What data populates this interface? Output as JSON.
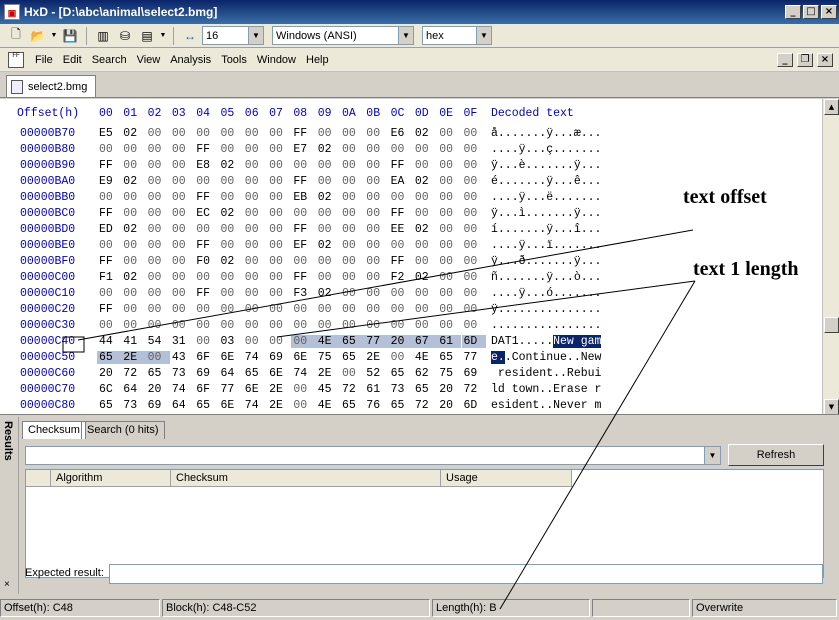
{
  "window": {
    "title": "HxD - [D:\\abc\\animal\\select2.bmg]",
    "app_icon": "HxD",
    "controls": [
      "minimize-icon",
      "maximize-icon",
      "close-icon"
    ]
  },
  "toolbar": {
    "bytes_per_row": "16",
    "charset": "Windows (ANSI)",
    "offset_base": "hex",
    "icons": [
      "new-file-icon",
      "open-file-icon",
      "save-icon",
      "chip-icon",
      "disk-icon",
      "page-icon",
      "arrows-icon"
    ]
  },
  "menu": {
    "items": [
      "File",
      "Edit",
      "Search",
      "View",
      "Analysis",
      "Tools",
      "Window",
      "Help"
    ]
  },
  "document_tab": {
    "label": "select2.bmg"
  },
  "hex_view": {
    "header_offset": "Offset(h)",
    "column_headers": [
      "00",
      "01",
      "02",
      "03",
      "04",
      "05",
      "06",
      "07",
      "08",
      "09",
      "0A",
      "0B",
      "0C",
      "0D",
      "0E",
      "0F"
    ],
    "header_decoded": "Decoded text",
    "rows": [
      {
        "offset": "00000B70",
        "bytes": [
          "E5",
          "02",
          "00",
          "00",
          "00",
          "00",
          "00",
          "00",
          "FF",
          "00",
          "00",
          "00",
          "E6",
          "02",
          "00",
          "00"
        ],
        "decoded": "å.......ÿ...æ..."
      },
      {
        "offset": "00000B80",
        "bytes": [
          "00",
          "00",
          "00",
          "00",
          "FF",
          "00",
          "00",
          "00",
          "E7",
          "02",
          "00",
          "00",
          "00",
          "00",
          "00",
          "00"
        ],
        "decoded": "....ÿ...ç......."
      },
      {
        "offset": "00000B90",
        "bytes": [
          "FF",
          "00",
          "00",
          "00",
          "E8",
          "02",
          "00",
          "00",
          "00",
          "00",
          "00",
          "00",
          "FF",
          "00",
          "00",
          "00"
        ],
        "decoded": "ÿ...è.......ÿ..."
      },
      {
        "offset": "00000BA0",
        "bytes": [
          "E9",
          "02",
          "00",
          "00",
          "00",
          "00",
          "00",
          "00",
          "FF",
          "00",
          "00",
          "00",
          "EA",
          "02",
          "00",
          "00"
        ],
        "decoded": "é.......ÿ...ê..."
      },
      {
        "offset": "00000BB0",
        "bytes": [
          "00",
          "00",
          "00",
          "00",
          "FF",
          "00",
          "00",
          "00",
          "EB",
          "02",
          "00",
          "00",
          "00",
          "00",
          "00",
          "00"
        ],
        "decoded": "....ÿ...ë......."
      },
      {
        "offset": "00000BC0",
        "bytes": [
          "FF",
          "00",
          "00",
          "00",
          "EC",
          "02",
          "00",
          "00",
          "00",
          "00",
          "00",
          "00",
          "FF",
          "00",
          "00",
          "00"
        ],
        "decoded": "ÿ...ì.......ÿ..."
      },
      {
        "offset": "00000BD0",
        "bytes": [
          "ED",
          "02",
          "00",
          "00",
          "00",
          "00",
          "00",
          "00",
          "FF",
          "00",
          "00",
          "00",
          "EE",
          "02",
          "00",
          "00"
        ],
        "decoded": "í.......ÿ...î..."
      },
      {
        "offset": "00000BE0",
        "bytes": [
          "00",
          "00",
          "00",
          "00",
          "FF",
          "00",
          "00",
          "00",
          "EF",
          "02",
          "00",
          "00",
          "00",
          "00",
          "00",
          "00"
        ],
        "decoded": "....ÿ...ï......."
      },
      {
        "offset": "00000BF0",
        "bytes": [
          "FF",
          "00",
          "00",
          "00",
          "F0",
          "02",
          "00",
          "00",
          "00",
          "00",
          "00",
          "00",
          "FF",
          "00",
          "00",
          "00"
        ],
        "decoded": "ÿ...ð.......ÿ..."
      },
      {
        "offset": "00000C00",
        "bytes": [
          "F1",
          "02",
          "00",
          "00",
          "00",
          "00",
          "00",
          "00",
          "FF",
          "00",
          "00",
          "00",
          "F2",
          "02",
          "00",
          "00"
        ],
        "decoded": "ñ.......ÿ...ò..."
      },
      {
        "offset": "00000C10",
        "bytes": [
          "00",
          "00",
          "00",
          "00",
          "FF",
          "00",
          "00",
          "00",
          "F3",
          "02",
          "00",
          "00",
          "00",
          "00",
          "00",
          "00"
        ],
        "decoded": "....ÿ...ó......."
      },
      {
        "offset": "00000C20",
        "bytes": [
          "FF",
          "00",
          "00",
          "00",
          "00",
          "00",
          "00",
          "00",
          "00",
          "00",
          "00",
          "00",
          "00",
          "00",
          "00",
          "00"
        ],
        "decoded": "ÿ..............."
      },
      {
        "offset": "00000C30",
        "bytes": [
          "00",
          "00",
          "00",
          "00",
          "00",
          "00",
          "00",
          "00",
          "00",
          "00",
          "00",
          "00",
          "00",
          "00",
          "00",
          "00"
        ],
        "decoded": "................"
      },
      {
        "offset": "00000C40",
        "bytes": [
          "44",
          "41",
          "54",
          "31",
          "00",
          "03",
          "00",
          "00",
          "00",
          "4E",
          "65",
          "77",
          "20",
          "67",
          "61",
          "6D"
        ],
        "decoded_plain": "DAT1.....",
        "decoded_sel": "New gam"
      },
      {
        "offset": "00000C50",
        "bytes": [
          "65",
          "2E",
          "00",
          "43",
          "6F",
          "6E",
          "74",
          "69",
          "6E",
          "75",
          "65",
          "2E",
          "00",
          "4E",
          "65",
          "77"
        ],
        "decoded_sel": "e.",
        "decoded_plain": ".Continue..New"
      },
      {
        "offset": "00000C60",
        "bytes": [
          "20",
          "72",
          "65",
          "73",
          "69",
          "64",
          "65",
          "6E",
          "74",
          "2E",
          "00",
          "52",
          "65",
          "62",
          "75",
          "69"
        ],
        "decoded": " resident..Rebui"
      },
      {
        "offset": "00000C70",
        "bytes": [
          "6C",
          "64",
          "20",
          "74",
          "6F",
          "77",
          "6E",
          "2E",
          "00",
          "45",
          "72",
          "61",
          "73",
          "65",
          "20",
          "72"
        ],
        "decoded": "ld town..Erase r"
      },
      {
        "offset": "00000C80",
        "bytes": [
          "65",
          "73",
          "69",
          "64",
          "65",
          "6E",
          "74",
          "2E",
          "00",
          "4E",
          "65",
          "76",
          "65",
          "72",
          "20",
          "6D"
        ],
        "decoded": "esident..Never m"
      }
    ]
  },
  "results": {
    "side_label": "Results",
    "tabs": [
      "Checksum",
      "Search (0 hits)"
    ],
    "refresh_label": "Refresh",
    "columns": [
      "Algorithm",
      "Checksum",
      "Usage"
    ],
    "expected_label": "Expected result:"
  },
  "status": {
    "offset": "Offset(h): C48",
    "block": "Block(h): C48-C52",
    "length": "Length(h): B",
    "mode": "Overwrite"
  },
  "annotations": {
    "text_offset": "text offset",
    "text_length": "text 1 length"
  }
}
